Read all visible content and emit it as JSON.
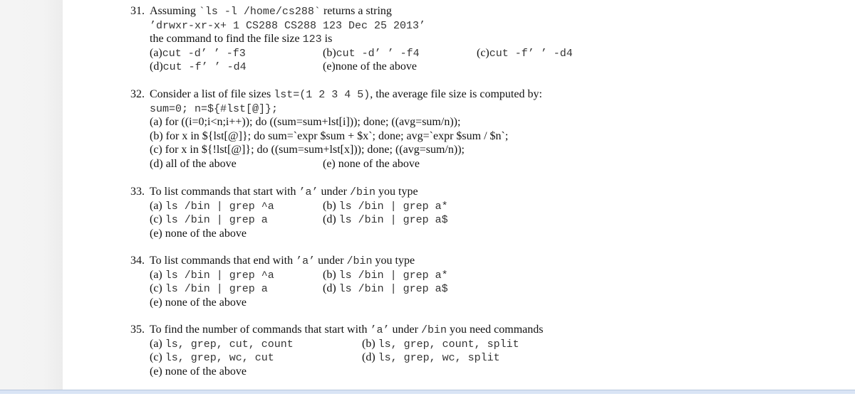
{
  "questions": [
    {
      "number": "31.",
      "prompt_prefix": "Assuming ",
      "prompt_code": "`ls -l /home/cs288`",
      "prompt_suffix": " returns a string",
      "string_line": "’drwxr-xr-x+ 1 CS288 CS288 123 Dec 25 2013’",
      "line3_prefix": "the command to find the file size ",
      "line3_code": "123",
      "line3_suffix": " is",
      "options": [
        {
          "label": "(a)",
          "text": "cut -d’ ’ -f3",
          "mono": true
        },
        {
          "label": "(b)",
          "text": "cut -d’ ’ -f4",
          "mono": true
        },
        {
          "label": "(c)",
          "text": "cut -f’ ’ -d4",
          "mono": true
        },
        {
          "label": "(d)",
          "text": "cut -f’ ’ -d4",
          "mono": true
        },
        {
          "label": "(e)",
          "text": "none of the above",
          "mono": false
        }
      ]
    },
    {
      "number": "32.",
      "prompt_prefix": "Consider a list of file sizes ",
      "prompt_code": "lst=(1 2 3 4 5)",
      "prompt_suffix": ", the average file size is computed by:",
      "init_line": "sum=0; n=${#lst[@]};",
      "options": [
        {
          "label": "(a)",
          "text": "for ((i=0;i<n;i++)); do ((sum=sum+lst[i])); done; ((avg=sum/n));"
        },
        {
          "label": "(b)",
          "text": "for x in ${lst[@]}; do sum=`expr $sum + $x`; done; avg=`expr $sum / $n`;"
        },
        {
          "label": "(c)",
          "text": "for x in ${!lst[@]}; do ((sum=sum+lst[x])); done; ((avg=sum/n));"
        },
        {
          "label": "(d)",
          "text": "all of the above"
        },
        {
          "label": "(e)",
          "text": "none of the above"
        }
      ]
    },
    {
      "number": "33.",
      "prompt_prefix": "To list commands that start with ",
      "prompt_code": "’a’",
      "prompt_mid": " under ",
      "prompt_code2": "/bin",
      "prompt_suffix": " you type",
      "options": [
        {
          "label": "(a)",
          "text": "ls /bin | grep ^a"
        },
        {
          "label": "(b)",
          "text": "ls /bin | grep a*"
        },
        {
          "label": "(c)",
          "text": "ls /bin | grep a"
        },
        {
          "label": "(d)",
          "text": "ls /bin | grep a$"
        },
        {
          "label": "(e)",
          "text": "none of the above"
        }
      ]
    },
    {
      "number": "34.",
      "prompt_prefix": "To list commands that end with ",
      "prompt_code": "’a’",
      "prompt_mid": " under ",
      "prompt_code2": "/bin",
      "prompt_suffix": " you type",
      "options": [
        {
          "label": "(a)",
          "text": "ls /bin | grep ^a"
        },
        {
          "label": "(b)",
          "text": "ls /bin | grep a*"
        },
        {
          "label": "(c)",
          "text": "ls /bin | grep a"
        },
        {
          "label": "(d)",
          "text": "ls /bin | grep a$"
        },
        {
          "label": "(e)",
          "text": "none of the above"
        }
      ]
    },
    {
      "number": "35.",
      "prompt_prefix": "To find the number of commands that start with ",
      "prompt_code": "’a’",
      "prompt_mid": " under ",
      "prompt_code2": "/bin",
      "prompt_suffix": " you need commands",
      "options": [
        {
          "label": "(a)",
          "text": "ls, grep, cut, count"
        },
        {
          "label": "(b)",
          "text": "ls, grep, count, split"
        },
        {
          "label": "(c)",
          "text": "ls, grep, wc, cut"
        },
        {
          "label": "(d)",
          "text": "ls, grep, wc, split"
        },
        {
          "label": "(e)",
          "text": "none of the above"
        }
      ]
    }
  ]
}
